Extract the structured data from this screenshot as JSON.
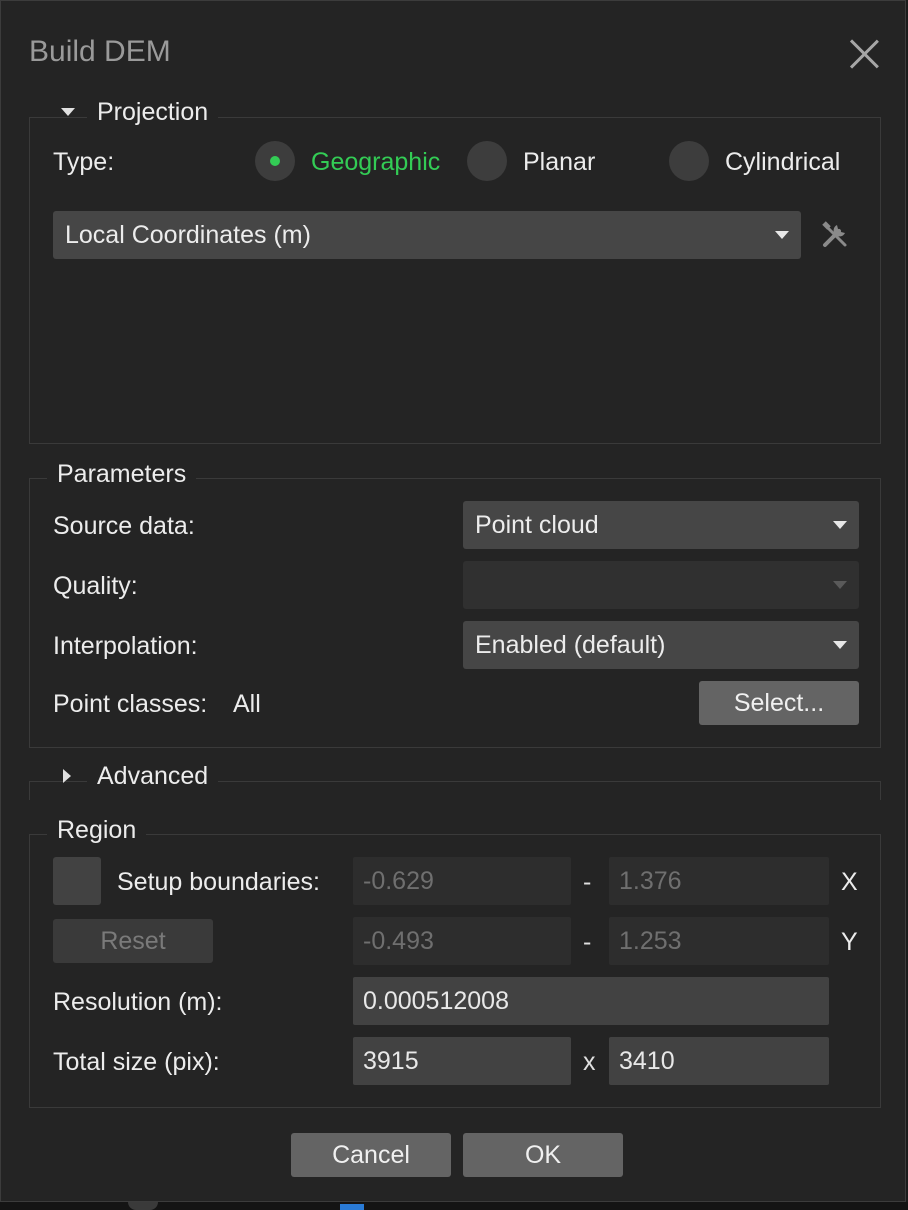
{
  "dialog": {
    "title": "Build DEM"
  },
  "projection": {
    "legend": "Projection",
    "type_label": "Type:",
    "options": [
      "Geographic",
      "Planar",
      "Cylindrical"
    ],
    "selected": "Geographic",
    "crs_value": "Local Coordinates (m)",
    "selected_color": "#33cc55"
  },
  "parameters": {
    "legend": "Parameters",
    "source_label": "Source data:",
    "source_value": "Point cloud",
    "quality_label": "Quality:",
    "quality_value": "",
    "interpolation_label": "Interpolation:",
    "interpolation_value": "Enabled (default)",
    "point_classes_label": "Point classes:",
    "point_classes_value": "All",
    "select_button": "Select..."
  },
  "advanced": {
    "legend": "Advanced"
  },
  "region": {
    "legend": "Region",
    "setup_label": "Setup boundaries:",
    "reset_button": "Reset",
    "x_min": "-0.629",
    "x_max": "1.376",
    "x_label": "X",
    "y_min": "-0.493",
    "y_max": "1.253",
    "y_label": "Y",
    "dash": "-",
    "resolution_label": "Resolution (m):",
    "resolution_value": "0.000512008",
    "total_size_label": "Total size (pix):",
    "width_pix": "3915",
    "times": "x",
    "height_pix": "3410"
  },
  "footer": {
    "cancel": "Cancel",
    "ok": "OK"
  }
}
